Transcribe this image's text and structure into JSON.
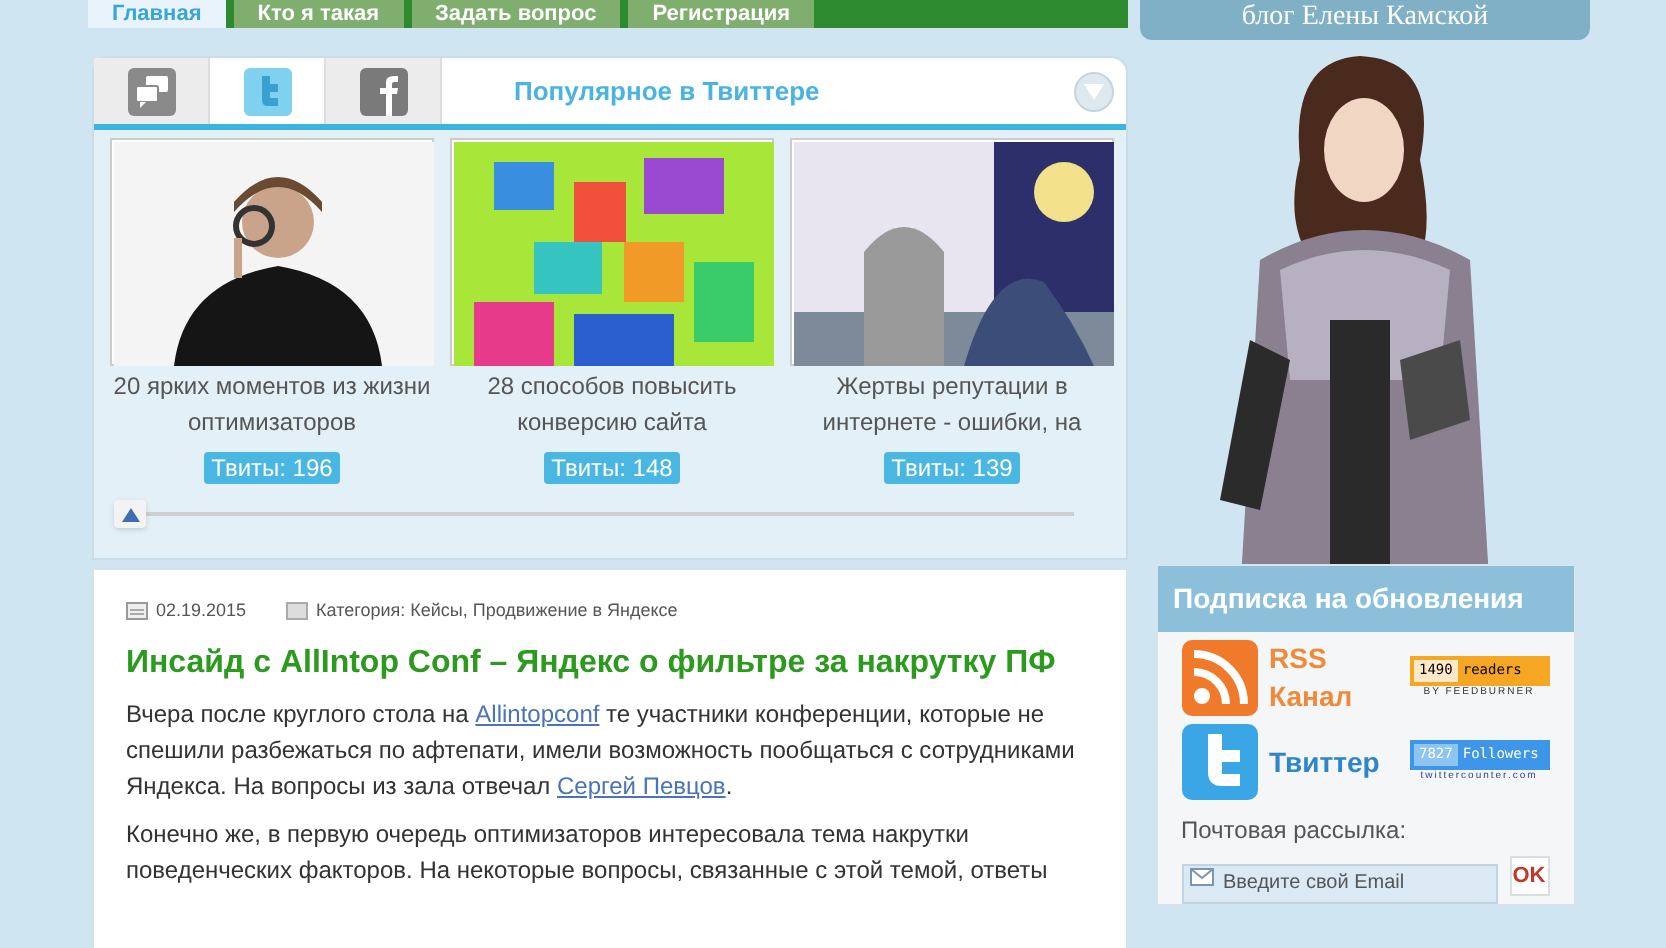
{
  "nav": [
    {
      "label": "Главная",
      "selected": true
    },
    {
      "label": "Кто я такая",
      "selected": false
    },
    {
      "label": "Задать вопрос",
      "selected": false
    },
    {
      "label": "Регистрация",
      "selected": false
    }
  ],
  "blog_title": "блог Елены Камской",
  "popular": {
    "tabs": [
      {
        "kind": "comments",
        "selected": false
      },
      {
        "kind": "twitter",
        "selected": true
      },
      {
        "kind": "facebook",
        "selected": false
      }
    ],
    "title": "Популярное в Твиттере",
    "items": [
      {
        "title": "20 ярких моментов из жизни оптимизаторов",
        "tweets": "Твиты: 196"
      },
      {
        "title": "28 способов повысить конверсию сайта",
        "tweets": "Твиты: 148"
      },
      {
        "title": "Жертвы репутации в интернете - ошибки, на",
        "tweets": "Твиты: 139"
      }
    ],
    "scroll": {
      "level": 0
    }
  },
  "post": {
    "date": "02.19.2015",
    "category": "Категория: Кейсы, Продвижение в Яндексе",
    "title": "Инсайд с AllIntop Conf – Яндекс о фильтре за накрутку ПФ",
    "paragraphs": [
      [
        {
          "text": "Вчера после круглого стола на "
        },
        {
          "text": "Allintopconf",
          "link": true
        },
        {
          "text": " те участники конференции, которые не спешили разбежаться по афтепати, имели возможность пообщаться с сотрудниками Яндекса. На вопросы из зала отвечал "
        },
        {
          "text": "Сергей Певцов",
          "link": true
        },
        {
          "text": "."
        }
      ],
      [
        {
          "text": "Конечно же, в первую очередь оптимизаторов интересовала тема накрутки поведенческих факторов. На некоторые вопросы, связанные с этой темой, ответы"
        }
      ]
    ]
  },
  "subscribe": {
    "title": "Подписка на обновления",
    "channels": [
      {
        "kind": "rss",
        "label": "RSS Канал",
        "count": "1490",
        "unit": "readers",
        "source": "BY FEEDBURNER"
      },
      {
        "kind": "twitter",
        "label": "Твиттер",
        "count": "7827",
        "unit": "Followers",
        "source": "twittercounter.com"
      }
    ],
    "mail_label": "Почтовая рассылка:",
    "email": {
      "placeholder": "Введите свой Email"
    },
    "button": "OK"
  }
}
